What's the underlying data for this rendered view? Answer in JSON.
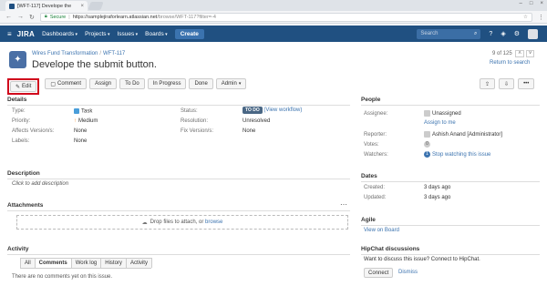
{
  "browser": {
    "tab_title": "[WFT-117] Develope the",
    "secure_label": "Secure",
    "url_host": "https://samplejiraforlearn.atlassian.net",
    "url_path": "/browse/WFT-117?filter=-4"
  },
  "header": {
    "logo": "JIRA",
    "nav": [
      "Dashboards",
      "Projects",
      "Issues",
      "Boards"
    ],
    "create_label": "Create",
    "search_placeholder": "Search"
  },
  "issue": {
    "project": "Wires Fund Transformation",
    "key": "WFT-117",
    "title": "Develope the submit button.",
    "pager": "9 of 125",
    "return_label": "Return to search"
  },
  "toolbar": {
    "edit": "Edit",
    "comment": "Comment",
    "assign": "Assign",
    "todo": "To Do",
    "in_progress": "In Progress",
    "done": "Done",
    "admin": "Admin"
  },
  "details": {
    "title": "Details",
    "type_label": "Type:",
    "type_value": "Task",
    "priority_label": "Priority:",
    "priority_value": "Medium",
    "affects_label": "Affects Version/s:",
    "affects_value": "None",
    "labels_label": "Labels:",
    "labels_value": "None",
    "status_label": "Status:",
    "status_value": "TO DO",
    "workflow_link": "(View workflow)",
    "resolution_label": "Resolution:",
    "resolution_value": "Unresolved",
    "fix_label": "Fix Version/s:",
    "fix_value": "None"
  },
  "description": {
    "title": "Description",
    "placeholder": "Click to add description"
  },
  "attachments": {
    "title": "Attachments",
    "drop_text": "Drop files to attach, or",
    "browse": "browse"
  },
  "activity": {
    "title": "Activity",
    "tabs": [
      "All",
      "Comments",
      "Work log",
      "History",
      "Activity"
    ],
    "empty": "There are no comments yet on this issue."
  },
  "people": {
    "title": "People",
    "assignee_label": "Assignee:",
    "assignee_value": "Unassigned",
    "assign_to_me": "Assign to me",
    "reporter_label": "Reporter:",
    "reporter_value": "Ashish Anand [Administrator]",
    "votes_label": "Votes:",
    "votes_value": "0",
    "watchers_label": "Watchers:",
    "watchers_count": "1",
    "watchers_value": "Stop watching this issue"
  },
  "dates": {
    "title": "Dates",
    "created_label": "Created:",
    "created_value": "3 days ago",
    "updated_label": "Updated:",
    "updated_value": "3 days ago"
  },
  "agile": {
    "title": "Agile",
    "board_link": "View on Board"
  },
  "hipchat": {
    "title": "HipChat discussions",
    "prompt": "Want to discuss this issue? Connect to HipChat.",
    "connect": "Connect",
    "dismiss": "Dismiss"
  }
}
